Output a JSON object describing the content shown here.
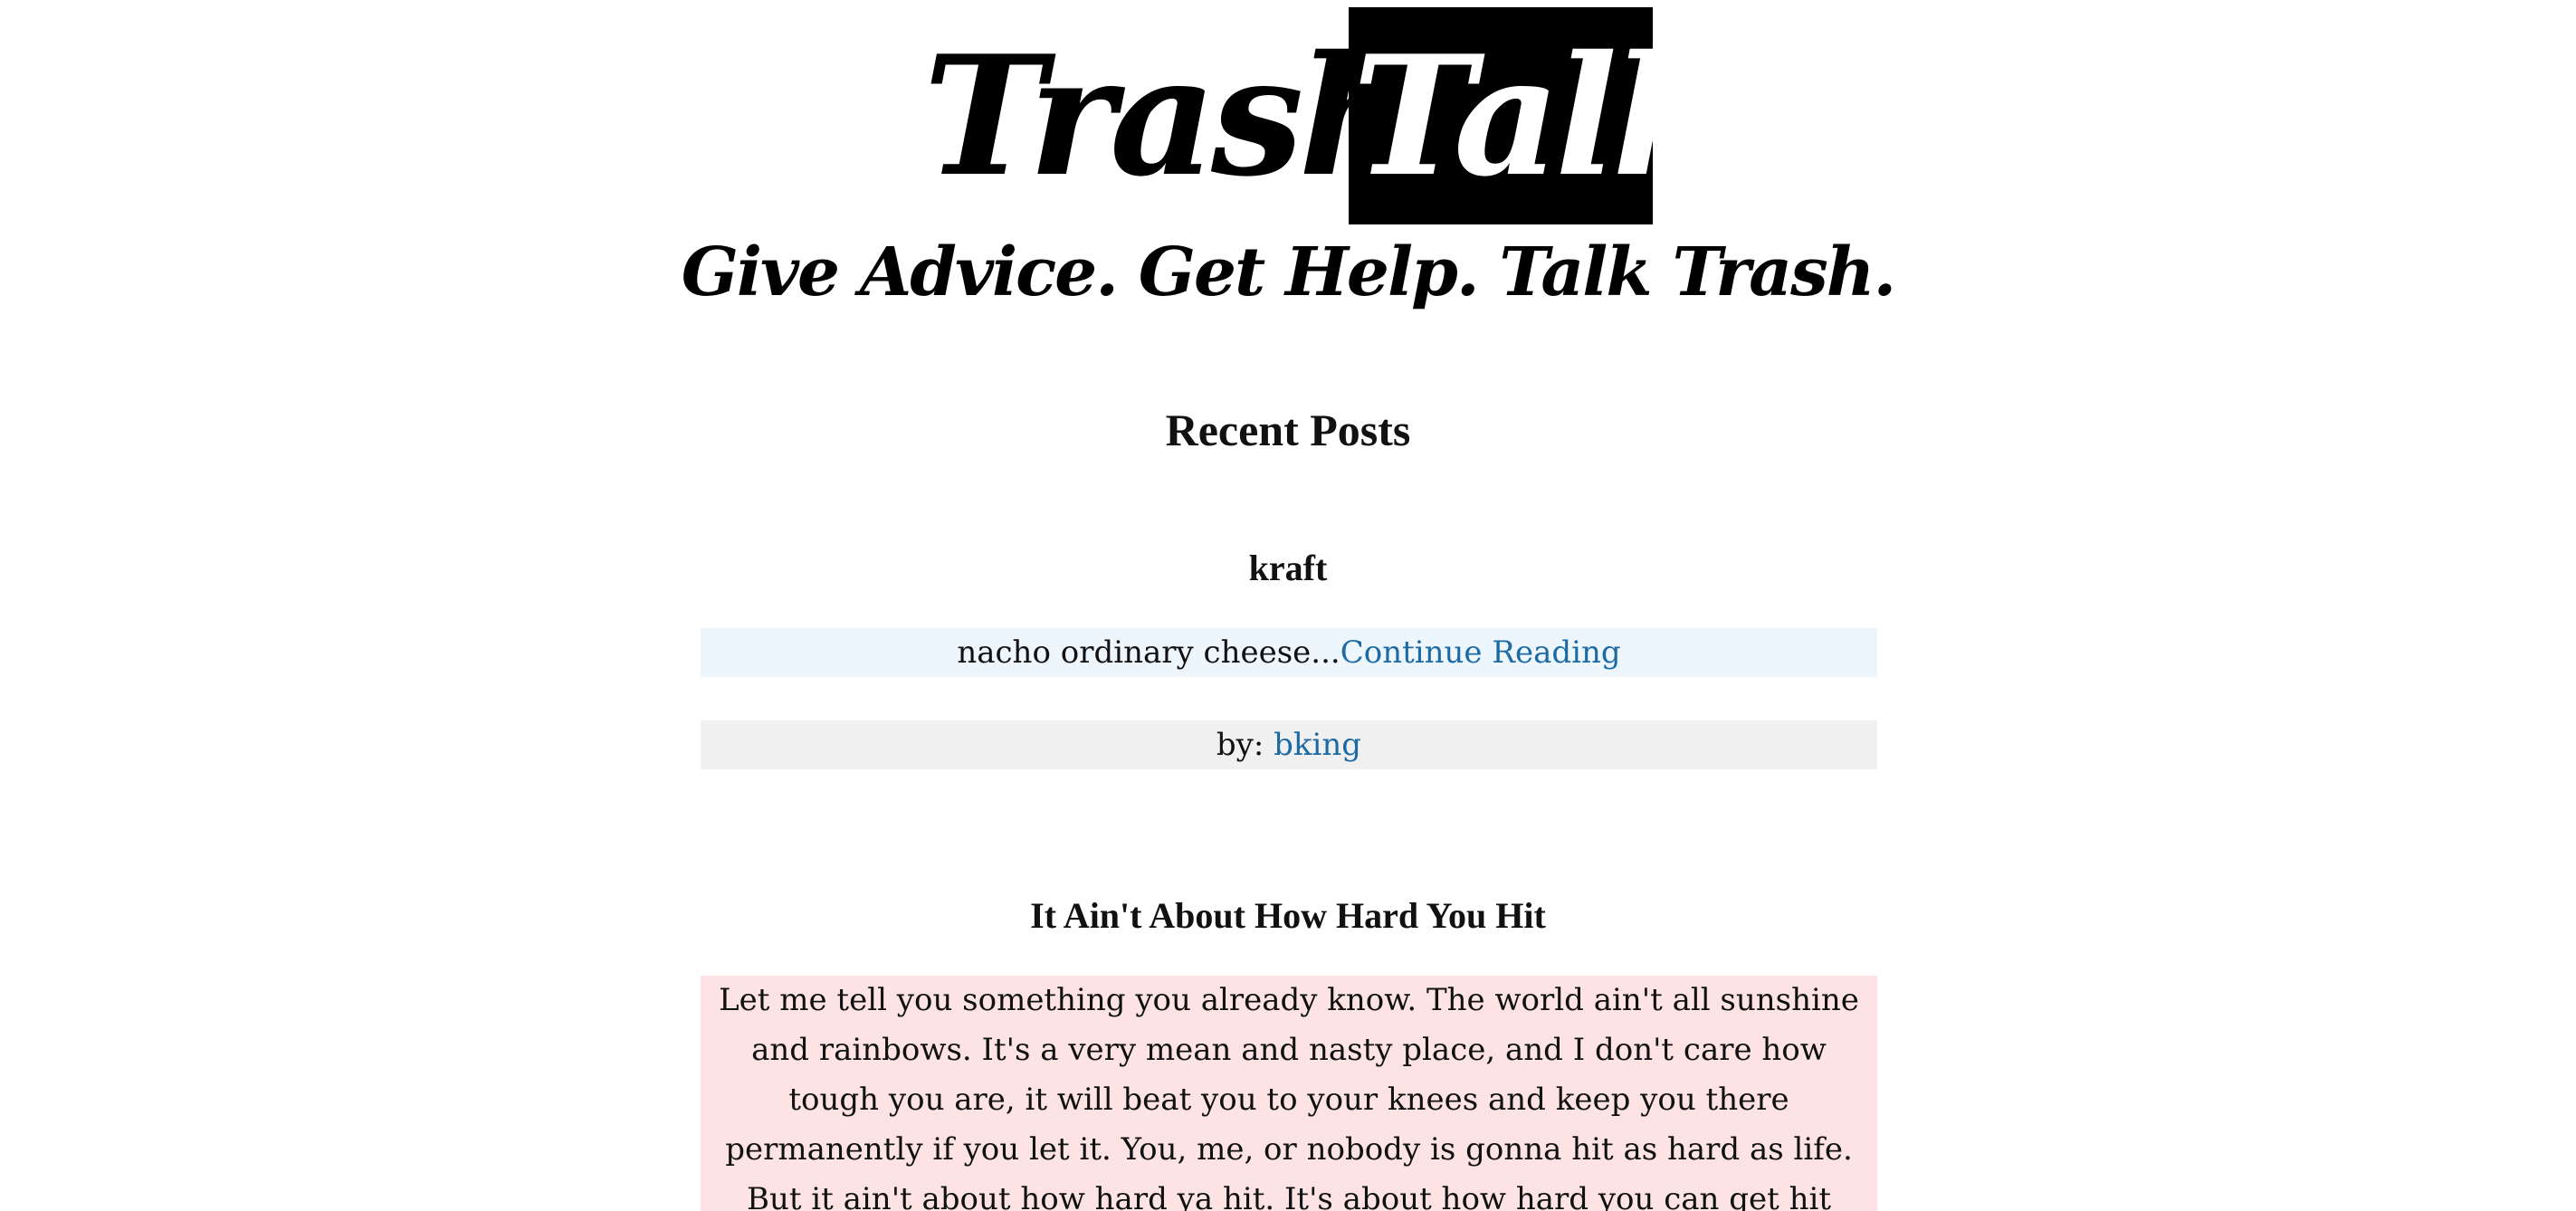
{
  "header": {
    "logo_word_1": "Trash",
    "logo_word_2": "Talk",
    "tagline": "Give Advice. Get Help. Talk Trash."
  },
  "main": {
    "section_title": "Recent Posts",
    "posts": [
      {
        "title": "kraft",
        "excerpt": "nacho ordinary cheese...",
        "continue_label": "Continue Reading",
        "byline_prefix": "by:",
        "author": "bking"
      },
      {
        "title": "It Ain't About How Hard You Hit",
        "excerpt": "Let me tell you something you already know. The world ain't all sunshine and rainbows. It's a very mean and nasty place, and I don't care how tough you are, it will beat you to your knees and keep you there permanently if you let it. You, me, or nobody is gonna hit as hard as life. But it ain't about how hard ya hit. It's about how hard you can get hit and keep moving forward."
      }
    ]
  },
  "colors": {
    "link": "#1b6aa6",
    "excerpt_bg_1": "#eef6fd",
    "byline_bg": "#f0f0f0",
    "excerpt_bg_2": "#fde3e4"
  }
}
